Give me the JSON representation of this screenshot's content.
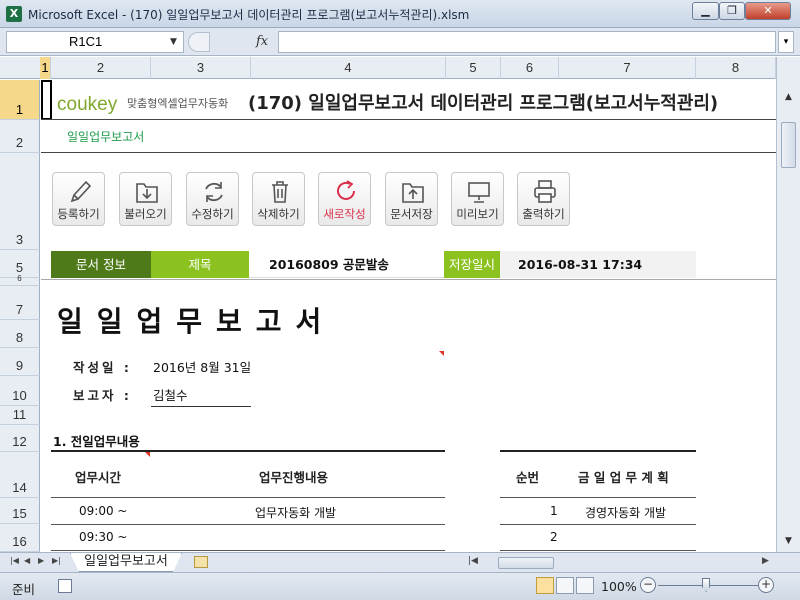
{
  "window": {
    "title": "Microsoft Excel - (170) 일일업무보고서 데이터관리 프로그램(보고서누적관리).xlsm",
    "app_icon": "X"
  },
  "formula_bar": {
    "name_box": "R1C1",
    "fx": "fx",
    "formula": ""
  },
  "columns": [
    "1",
    "2",
    "3",
    "4",
    "5",
    "6",
    "7",
    "8"
  ],
  "rows": [
    "1",
    "2",
    "3",
    "5",
    "6",
    "7",
    "8",
    "9",
    "10",
    "11",
    "12",
    "14",
    "15",
    "16"
  ],
  "header": {
    "logo": "coukey",
    "logo_sub": "맞춤형엑셀업무자동화",
    "title": "(170) 일일업무보고서 데이터관리 프로그램(보고서누적관리)",
    "subtitle": "일일업무보고서"
  },
  "toolbar": [
    {
      "label": "등록하기",
      "icon": "pencil-icon"
    },
    {
      "label": "불러오기",
      "icon": "load-icon"
    },
    {
      "label": "수정하기",
      "icon": "refresh-icon"
    },
    {
      "label": "삭제하기",
      "icon": "trash-icon"
    },
    {
      "label": "새로작성",
      "icon": "new-icon"
    },
    {
      "label": "문서저장",
      "icon": "save-icon"
    },
    {
      "label": "미리보기",
      "icon": "preview-icon"
    },
    {
      "label": "출력하기",
      "icon": "print-icon"
    }
  ],
  "info": {
    "doc_info_label": "문서 정보",
    "subject_label": "제목",
    "subject_value": "20160809 공문발송",
    "saved_label": "저장일시",
    "saved_value": "2016-08-31 17:34"
  },
  "report": {
    "title": "일일업무보고서",
    "author_label": "작성일 :",
    "author_date": "2016년 8월 31일",
    "reporter_label": "보고자 :",
    "reporter_value": "김철수",
    "section1": "1. 전일업무내용"
  },
  "work_table": {
    "headers": [
      "업무시간",
      "업무진행내용"
    ],
    "rows": [
      [
        "09:00 ~",
        "업무자동화 개발"
      ],
      [
        "09:30 ~",
        ""
      ]
    ]
  },
  "plan_table": {
    "headers": [
      "순번",
      "금 일 업 무 계 획"
    ],
    "rows": [
      [
        "1",
        "경영자동화 개발"
      ],
      [
        "2",
        ""
      ]
    ]
  },
  "sheet_tab": "일일업무보고서",
  "status": {
    "mode": "준비",
    "zoom": "100%"
  }
}
